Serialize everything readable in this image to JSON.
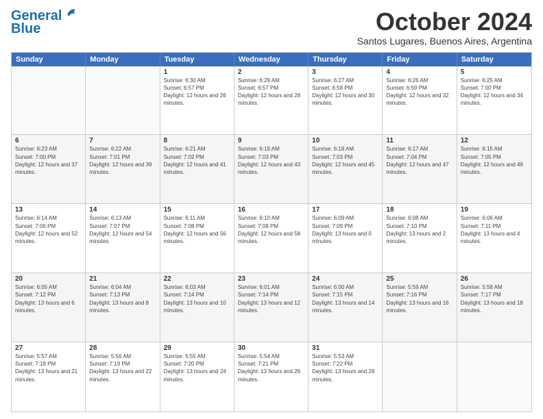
{
  "logo": {
    "line1": "General",
    "line2": "Blue"
  },
  "title": "October 2024",
  "location": "Santos Lugares, Buenos Aires, Argentina",
  "days": [
    "Sunday",
    "Monday",
    "Tuesday",
    "Wednesday",
    "Thursday",
    "Friday",
    "Saturday"
  ],
  "weeks": [
    [
      {
        "num": "",
        "empty": true
      },
      {
        "num": "",
        "empty": true
      },
      {
        "num": "1",
        "rise": "6:30 AM",
        "set": "6:57 PM",
        "daylight": "12 hours and 26 minutes."
      },
      {
        "num": "2",
        "rise": "6:29 AM",
        "set": "6:57 PM",
        "daylight": "12 hours and 28 minutes."
      },
      {
        "num": "3",
        "rise": "6:27 AM",
        "set": "6:58 PM",
        "daylight": "12 hours and 30 minutes."
      },
      {
        "num": "4",
        "rise": "6:26 AM",
        "set": "6:59 PM",
        "daylight": "12 hours and 32 minutes."
      },
      {
        "num": "5",
        "rise": "6:25 AM",
        "set": "7:00 PM",
        "daylight": "12 hours and 34 minutes."
      }
    ],
    [
      {
        "num": "6",
        "rise": "6:23 AM",
        "set": "7:00 PM",
        "daylight": "12 hours and 37 minutes."
      },
      {
        "num": "7",
        "rise": "6:22 AM",
        "set": "7:01 PM",
        "daylight": "12 hours and 39 minutes."
      },
      {
        "num": "8",
        "rise": "6:21 AM",
        "set": "7:02 PM",
        "daylight": "12 hours and 41 minutes."
      },
      {
        "num": "9",
        "rise": "6:19 AM",
        "set": "7:03 PM",
        "daylight": "12 hours and 43 minutes."
      },
      {
        "num": "10",
        "rise": "6:18 AM",
        "set": "7:03 PM",
        "daylight": "12 hours and 45 minutes."
      },
      {
        "num": "11",
        "rise": "6:17 AM",
        "set": "7:04 PM",
        "daylight": "12 hours and 47 minutes."
      },
      {
        "num": "12",
        "rise": "6:15 AM",
        "set": "7:05 PM",
        "daylight": "12 hours and 49 minutes."
      }
    ],
    [
      {
        "num": "13",
        "rise": "6:14 AM",
        "set": "7:06 PM",
        "daylight": "12 hours and 52 minutes."
      },
      {
        "num": "14",
        "rise": "6:13 AM",
        "set": "7:07 PM",
        "daylight": "12 hours and 54 minutes."
      },
      {
        "num": "15",
        "rise": "6:11 AM",
        "set": "7:08 PM",
        "daylight": "12 hours and 56 minutes."
      },
      {
        "num": "16",
        "rise": "6:10 AM",
        "set": "7:08 PM",
        "daylight": "12 hours and 58 minutes."
      },
      {
        "num": "17",
        "rise": "6:09 AM",
        "set": "7:09 PM",
        "daylight": "13 hours and 0 minutes."
      },
      {
        "num": "18",
        "rise": "6:08 AM",
        "set": "7:10 PM",
        "daylight": "13 hours and 2 minutes."
      },
      {
        "num": "19",
        "rise": "6:06 AM",
        "set": "7:11 PM",
        "daylight": "13 hours and 4 minutes."
      }
    ],
    [
      {
        "num": "20",
        "rise": "6:05 AM",
        "set": "7:12 PM",
        "daylight": "13 hours and 6 minutes."
      },
      {
        "num": "21",
        "rise": "6:04 AM",
        "set": "7:13 PM",
        "daylight": "13 hours and 8 minutes."
      },
      {
        "num": "22",
        "rise": "6:03 AM",
        "set": "7:14 PM",
        "daylight": "13 hours and 10 minutes."
      },
      {
        "num": "23",
        "rise": "6:01 AM",
        "set": "7:14 PM",
        "daylight": "13 hours and 12 minutes."
      },
      {
        "num": "24",
        "rise": "6:00 AM",
        "set": "7:15 PM",
        "daylight": "13 hours and 14 minutes."
      },
      {
        "num": "25",
        "rise": "5:59 AM",
        "set": "7:16 PM",
        "daylight": "13 hours and 16 minutes."
      },
      {
        "num": "26",
        "rise": "5:58 AM",
        "set": "7:17 PM",
        "daylight": "13 hours and 18 minutes."
      }
    ],
    [
      {
        "num": "27",
        "rise": "5:57 AM",
        "set": "7:18 PM",
        "daylight": "13 hours and 21 minutes."
      },
      {
        "num": "28",
        "rise": "5:56 AM",
        "set": "7:19 PM",
        "daylight": "13 hours and 22 minutes."
      },
      {
        "num": "29",
        "rise": "5:55 AM",
        "set": "7:20 PM",
        "daylight": "13 hours and 24 minutes."
      },
      {
        "num": "30",
        "rise": "5:54 AM",
        "set": "7:21 PM",
        "daylight": "13 hours and 26 minutes."
      },
      {
        "num": "31",
        "rise": "5:53 AM",
        "set": "7:22 PM",
        "daylight": "13 hours and 28 minutes."
      },
      {
        "num": "",
        "empty": true
      },
      {
        "num": "",
        "empty": true
      }
    ]
  ]
}
